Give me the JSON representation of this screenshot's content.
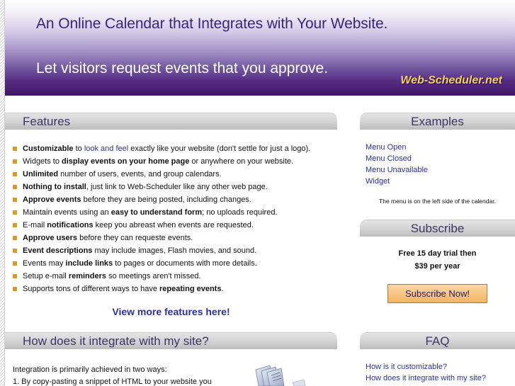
{
  "banner": {
    "headline": "An Online Calendar that Integrates with Your Website.",
    "subheadline": "Let visitors request events that you approve.",
    "brand": "Web-Scheduler.net"
  },
  "features": {
    "title": "Features",
    "items": [
      [
        {
          "t": "b",
          "v": "Customizable"
        },
        {
          "t": "s",
          "v": " to "
        },
        {
          "t": "a",
          "v": "look and feel"
        },
        {
          "t": "s",
          "v": " exactly like your website (don't settle for just a logo)."
        }
      ],
      [
        {
          "t": "s",
          "v": "Widgets to "
        },
        {
          "t": "b",
          "v": "display events on your home page"
        },
        {
          "t": "s",
          "v": " or anywhere on your website."
        }
      ],
      [
        {
          "t": "b",
          "v": "Unlimited"
        },
        {
          "t": "s",
          "v": " number of users, events, and group calendars."
        }
      ],
      [
        {
          "t": "b",
          "v": "Nothing to install"
        },
        {
          "t": "s",
          "v": ", just link to Web-Scheduler like any other web page."
        }
      ],
      [
        {
          "t": "b",
          "v": "Approve events"
        },
        {
          "t": "s",
          "v": " before they are being posted, including changes."
        }
      ],
      [
        {
          "t": "s",
          "v": "Maintain events using an "
        },
        {
          "t": "b",
          "v": "easy to understand form"
        },
        {
          "t": "s",
          "v": "; no uploads required."
        }
      ],
      [
        {
          "t": "s",
          "v": "E-mail "
        },
        {
          "t": "b",
          "v": "notifications"
        },
        {
          "t": "s",
          "v": " keep you abreast when events are requested."
        }
      ],
      [
        {
          "t": "b",
          "v": "Approve users"
        },
        {
          "t": "s",
          "v": " before they can requeste events."
        }
      ],
      [
        {
          "t": "b",
          "v": "Event descriptions"
        },
        {
          "t": "s",
          "v": " may include images, Flash movies, and sound."
        }
      ],
      [
        {
          "t": "s",
          "v": "Events may "
        },
        {
          "t": "b",
          "v": "include links"
        },
        {
          "t": "s",
          "v": " to pages or documents with more details."
        }
      ],
      [
        {
          "t": "s",
          "v": "Setup e-mail "
        },
        {
          "t": "b",
          "v": "reminders"
        },
        {
          "t": "s",
          "v": " so meetings aren't missed."
        }
      ],
      [
        {
          "t": "s",
          "v": "Supports tons of different ways to have "
        },
        {
          "t": "b",
          "v": "repeating events"
        },
        {
          "t": "s",
          "v": "."
        }
      ]
    ],
    "more_link": "View more features here!"
  },
  "integration": {
    "title": "How does it integrate with my site?",
    "line1": "Integration is primarily achieved in two ways:",
    "line2": "1. By copy-pasting a snippet of HTML to your website you"
  },
  "examples": {
    "title": "Examples",
    "links": [
      "Menu Open",
      "Menu Closed",
      "Menu Unavailable",
      "Widget"
    ],
    "note": "The menu is on the left side of the calendar."
  },
  "subscribe": {
    "title": "Subscribe",
    "trial_line1": "Free 15 day trial then",
    "trial_line2": "$39 per year",
    "button": "Subscribe Now!"
  },
  "faq": {
    "title": "FAQ",
    "links": [
      "How is it customizable?",
      "How does it integrate with my site?"
    ]
  }
}
